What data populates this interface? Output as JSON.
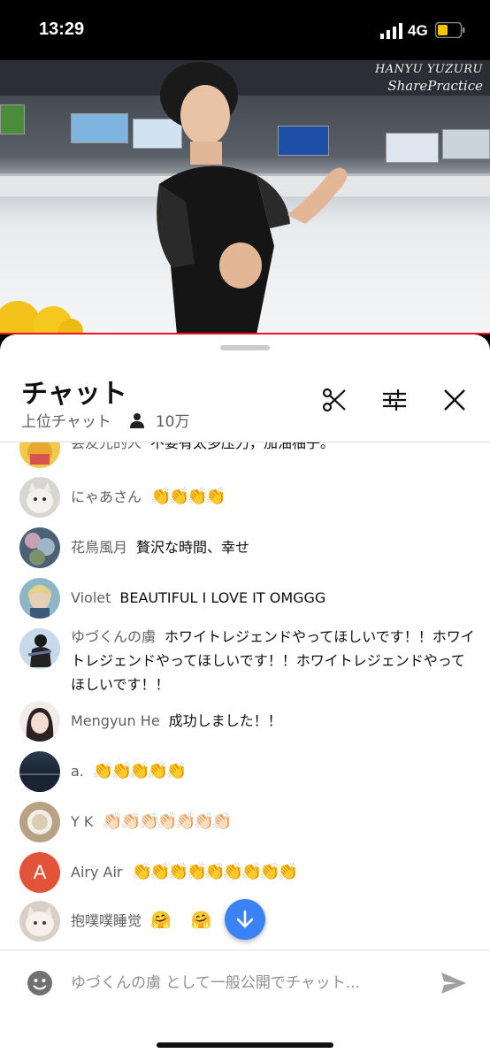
{
  "status_bar": {
    "time": "13:29",
    "network": "4G"
  },
  "video": {
    "watermark_line1": "HANYU YUZURU",
    "watermark_line2": "SharePractice"
  },
  "chat": {
    "title": "チャット",
    "mode": "上位チャット",
    "viewers": "10万",
    "input_placeholder": "ゆづくんの虜 として一般公開でチャット...",
    "messages": [
      {
        "author": "会友光的人",
        "text": "不要有太多压力，加油柚子。"
      },
      {
        "author": "にゃあさん",
        "text": "👏👏👏👏"
      },
      {
        "author": "花鳥風月",
        "text": "贅沢な時間、幸せ"
      },
      {
        "author": "Violet",
        "text": "BEAUTIFUL I LOVE IT OMGGG"
      },
      {
        "author": "ゆづくんの虜",
        "text": "ホワイトレジェンドやってほしいです！！ホワイトレジェンドやってほしいです！！ホワイトレジェンドやってほしいです！！"
      },
      {
        "author": "Mengyun He",
        "text": "成功しました！！"
      },
      {
        "author": "a.",
        "text": "👏👏👏👏👏"
      },
      {
        "author": "Y K",
        "text": "👏🏻👏🏻👏🏻👏🏻👏🏻👏🏻👏🏻"
      },
      {
        "author": "Airy Air",
        "text": "👏👏👏👏👏👏👏👏👏"
      },
      {
        "author": "抱噗噗睡觉",
        "text": "🤗 🤗"
      }
    ],
    "avatar_letter": "A"
  },
  "colors": {
    "accent_blue": "#3b82f6",
    "progress_red": "#ee1122",
    "airy_avatar": "#e2533a"
  }
}
